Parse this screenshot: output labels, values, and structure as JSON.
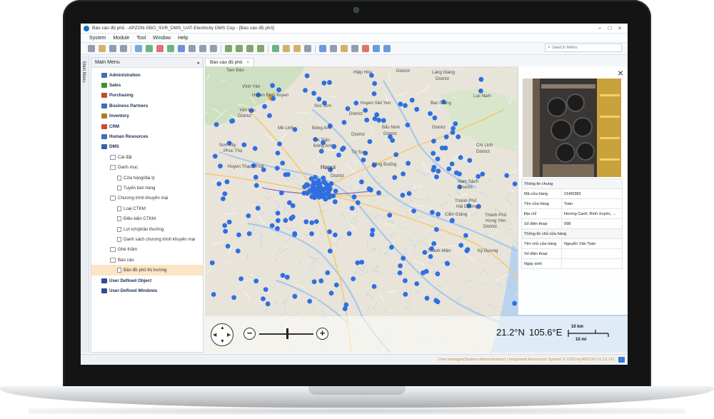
{
  "window": {
    "title": "Báo cáo độ phủ - APZON-SBO_SVR_DMS_UAT-Electricity DMS Cop - [Báo cáo độ phủ]",
    "minimize": "–",
    "maximize": "□",
    "close": "×"
  },
  "menu": [
    "System",
    "Module",
    "Tool",
    "Window",
    "Help"
  ],
  "search": {
    "placeholder": "Search Menu"
  },
  "side_strip_label": "Main Menu",
  "sidebar": {
    "title": "Main Menu",
    "collapse": "◂",
    "items": [
      {
        "label": "Administration",
        "level": 0,
        "icon": "person-icon",
        "color": "#3f6fb8"
      },
      {
        "label": "Sales",
        "level": 0,
        "icon": "sales-icon",
        "color": "#3d8f3a"
      },
      {
        "label": "Purchasing",
        "level": 0,
        "icon": "purchasing-icon",
        "color": "#c24a2b"
      },
      {
        "label": "Business Partners",
        "level": 0,
        "icon": "partners-icon",
        "color": "#3f6fb8"
      },
      {
        "label": "Inventory",
        "level": 0,
        "icon": "inventory-icon",
        "color": "#b07a2a"
      },
      {
        "label": "CRM",
        "level": 0,
        "icon": "crm-icon",
        "color": "#d0482f"
      },
      {
        "label": "Human Resources",
        "level": 0,
        "icon": "hr-icon",
        "color": "#3f6fb8"
      },
      {
        "label": "DMS",
        "level": 0,
        "icon": "dms-icon",
        "color": "#3a5fb0"
      },
      {
        "label": "Cài đặt",
        "level": 1,
        "icon": "folder-icon"
      },
      {
        "label": "Danh mục",
        "level": 1,
        "icon": "folder-icon"
      },
      {
        "label": "Cửa hàng/đại lý",
        "level": 2,
        "icon": "document-icon"
      },
      {
        "label": "Tuyến bán hàng",
        "level": 2,
        "icon": "document-icon"
      },
      {
        "label": "Chương trình khuyến mại",
        "level": 1,
        "icon": "folder-icon"
      },
      {
        "label": "Loại CTKM",
        "level": 2,
        "icon": "document-icon"
      },
      {
        "label": "Điều kiện CTKM",
        "level": 2,
        "icon": "document-icon"
      },
      {
        "label": "Lợi ích/phần thưởng",
        "level": 2,
        "icon": "document-icon"
      },
      {
        "label": "Danh sách chương trình khuyến mại",
        "level": 2,
        "icon": "document-icon"
      },
      {
        "label": "Ghé thăm",
        "level": 1,
        "icon": "folder-icon"
      },
      {
        "label": "Báo cáo",
        "level": 1,
        "icon": "folder-icon"
      },
      {
        "label": "Bản đồ phủ thị trường",
        "level": 2,
        "icon": "document-icon",
        "selected": true
      },
      {
        "label": "User Defined Object",
        "level": 0,
        "icon": "udo-icon",
        "color": "#2f4f8f"
      },
      {
        "label": "User-Defined Windows",
        "level": 0,
        "icon": "udw-icon",
        "color": "#2f4f8f"
      }
    ]
  },
  "tab": {
    "label": "Báo cáo độ phủ",
    "close": "×"
  },
  "map": {
    "point_color": "#2f6fe0",
    "labels": [
      "Tam Đảo",
      "Hiệp Hòa",
      "District",
      "Lạng Giang",
      "District",
      "Vĩnh Yên",
      "Huyen Binh Xuyen",
      "Sóc Sơn",
      "Huyen Viet Yen",
      "Bac Giang",
      "Lục Nam",
      "Yên Lạc",
      "District",
      "District",
      "Mê Linh",
      "Đông Anh",
      "Bắc Ninh",
      "District",
      "District",
      "Thị Trấn",
      "Đông Anh",
      "Từ Sơn",
      "Sơn Tây",
      "Phúc Thọ",
      "Huyen Thạch Thất",
      "Hanoi",
      "Chí Linh",
      "District",
      "Nam Sách",
      "District",
      "Thành Phố",
      "Hải Dương",
      "Thanh Miện",
      "Kỳ Dương",
      "Cẩm Giàng",
      "Thành Phố",
      "Hưng Yên",
      "District",
      "District",
      "District",
      "Sông Đuống"
    ],
    "latitude": "21.2°N",
    "longitude": "105.6°E",
    "scale_km": "10 km",
    "scale_mi": "10 mi",
    "zoom_level": 0.52
  },
  "detail": {
    "close": "×",
    "section1": "Thông tin chung",
    "rows1": [
      {
        "k": "Mã cửa hàng",
        "v": "CH00382"
      },
      {
        "k": "Tên cửa hàng",
        "v": "Toàn"
      },
      {
        "k": "Địa chỉ",
        "v": "Hương Canh, Bình Xuyên, ..."
      },
      {
        "k": "Số điện thoại",
        "v": "098"
      }
    ],
    "section2": "Thông tin chủ cửa hàng",
    "rows2": [
      {
        "k": "Tên chủ cửa hàng",
        "v": "Nguyễn Văn Toàn"
      },
      {
        "k": "Số điện thoại",
        "v": ""
      },
      {
        "k": "Ngày sinh",
        "v": ""
      }
    ]
  },
  "status": "User manager(System Administration) | Integrated Resources System © 2020 by APZON V2.10.141",
  "colors": {
    "accent": "#1f6fc7",
    "status_text": "#e08a2a",
    "selected_row": "#fde4c4"
  }
}
